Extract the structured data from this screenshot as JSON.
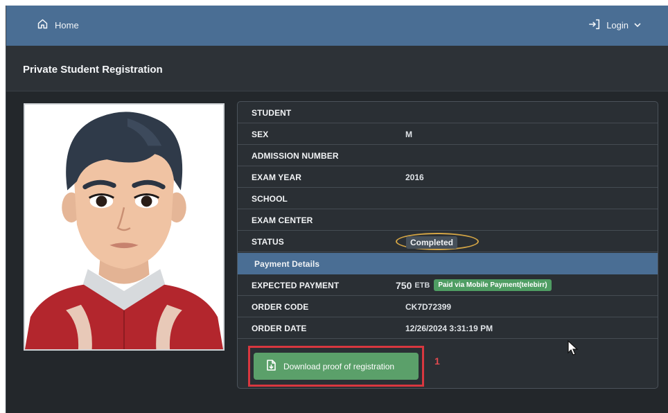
{
  "nav": {
    "home_label": "Home",
    "login_label": "Login"
  },
  "page": {
    "title": "Private Student Registration"
  },
  "student": {
    "rows": [
      {
        "label": "STUDENT",
        "value": ""
      },
      {
        "label": "SEX",
        "value": "M"
      },
      {
        "label": "ADMISSION NUMBER",
        "value": ""
      },
      {
        "label": "EXAM YEAR",
        "value": "2016"
      },
      {
        "label": "SCHOOL",
        "value": ""
      },
      {
        "label": "EXAM CENTER",
        "value": ""
      }
    ],
    "status_label": "STATUS",
    "status_value": "Completed"
  },
  "payment": {
    "section_title": "Payment Details",
    "expected_label": "EXPECTED PAYMENT",
    "amount": "750",
    "currency": "ETB",
    "paid_badge": "Paid via Mobile Payment(telebirr)",
    "order_code_label": "ORDER CODE",
    "order_code": "CK7D72399",
    "order_date_label": "ORDER DATE",
    "order_date": "12/26/2024 3:31:19 PM"
  },
  "actions": {
    "download_label": "Download proof of registration",
    "annotation_number": "1"
  },
  "colors": {
    "topbar": "#4a6e94",
    "background": "#23272b",
    "success": "#5ba06a",
    "highlight": "#d8373f",
    "status_ring": "#d4a545"
  },
  "icons": [
    "home-icon",
    "login-icon",
    "chevron-down-icon",
    "document-download-icon",
    "mouse-cursor-icon"
  ]
}
